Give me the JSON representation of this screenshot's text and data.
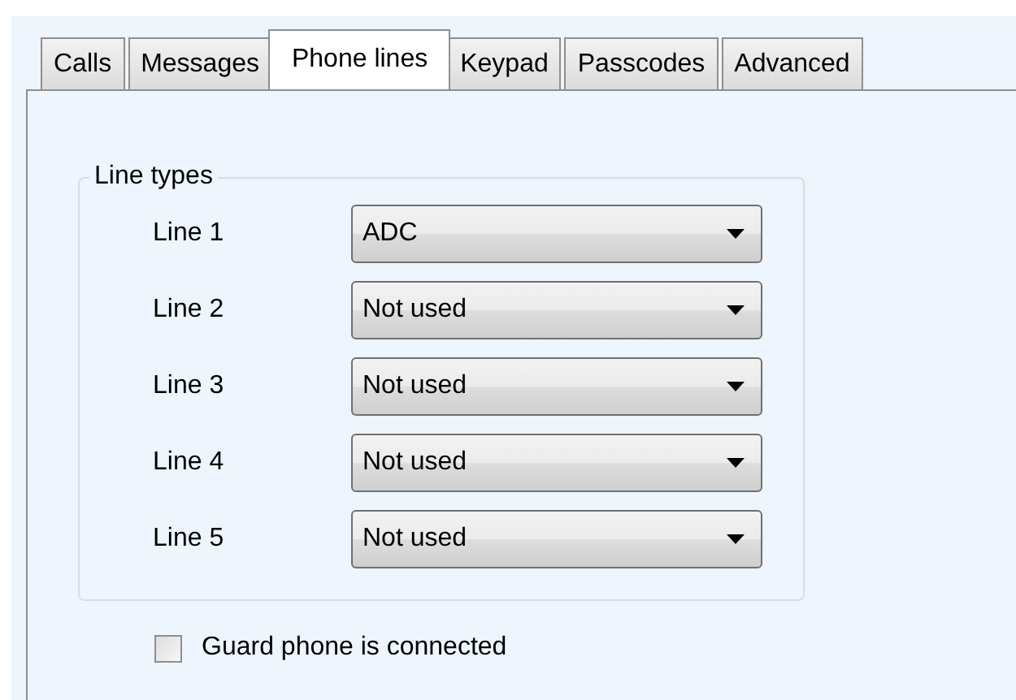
{
  "tabs": [
    {
      "label": "Calls",
      "selected": false
    },
    {
      "label": "Messages",
      "selected": false
    },
    {
      "label": "Phone lines",
      "selected": true
    },
    {
      "label": "Keypad",
      "selected": false
    },
    {
      "label": "Passcodes",
      "selected": false
    },
    {
      "label": "Advanced",
      "selected": false
    }
  ],
  "line_types": {
    "title": "Line types",
    "lines": [
      {
        "label": "Line 1",
        "value": "ADC"
      },
      {
        "label": "Line 2",
        "value": "Not used"
      },
      {
        "label": "Line 3",
        "value": "Not used"
      },
      {
        "label": "Line 4",
        "value": "Not used"
      },
      {
        "label": "Line 5",
        "value": "Not used"
      }
    ]
  },
  "guard_phone": {
    "label": "Guard phone is connected",
    "checked": false
  }
}
